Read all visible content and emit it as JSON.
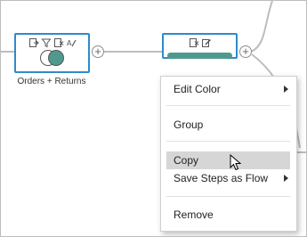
{
  "nodes": {
    "join": {
      "label": "Orders + Returns",
      "selected": true
    },
    "clean": {
      "selected": true
    }
  },
  "colors": {
    "selection_border": "#2e8bc9",
    "join_fill": "#4f9a8f",
    "menu_highlight": "#d6d6d6"
  },
  "icons": {
    "join_toolbar": [
      "exclude-icon",
      "filter-icon",
      "remove-icon",
      "rename-icon"
    ],
    "clean_toolbar": [
      "remove-icon",
      "edit-icon"
    ],
    "add_step": "plus-icon",
    "submenu": "chevron-right-icon"
  },
  "context_menu": {
    "edit_color": "Edit Color",
    "group": "Group",
    "copy": "Copy",
    "save_steps": "Save Steps as Flow",
    "remove": "Remove",
    "highlighted": "Copy"
  }
}
